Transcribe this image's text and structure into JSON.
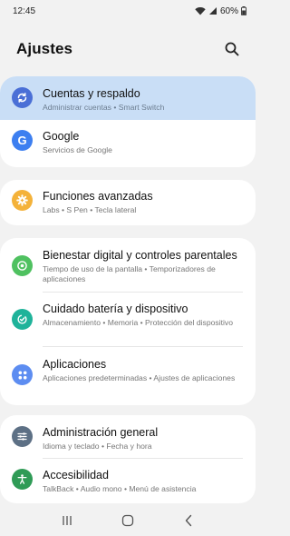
{
  "status_bar": {
    "time": "12:45",
    "battery": "60%"
  },
  "header": {
    "title": "Ajustes"
  },
  "colors": {
    "accent_blue": "#4a6fd6",
    "google_blue": "#3d7ff0",
    "advanced_yellow": "#f4b23a",
    "wellbeing_green": "#4fc160",
    "battery_teal": "#1fb39a",
    "apps_blue": "#5d8df1",
    "general_slate": "#5d7085",
    "accessibility_green": "#2f9b56",
    "highlight_bg": "#c9def6"
  },
  "cards": [
    {
      "items": [
        {
          "label": "Cuentas y respaldo",
          "sub": "Administrar cuentas  •  Smart Switch",
          "icon": "sync-icon",
          "highlighted": true
        },
        {
          "label": "Google",
          "sub": "Servicios de Google",
          "icon": "google-icon"
        }
      ]
    },
    {
      "items": [
        {
          "label": "Funciones avanzadas",
          "sub": "Labs  •  S Pen  •  Tecla lateral",
          "icon": "gear-plus-icon"
        }
      ]
    },
    {
      "items": [
        {
          "label": "Bienestar digital y controles parentales",
          "sub": "Tiempo de uso de la pantalla  •  Temporizadores de aplicaciones",
          "icon": "wellbeing-icon"
        },
        {
          "label": "Cuidado batería y dispositivo",
          "sub": "Almacenamiento  •  Memoria  •  Protección del dispositivo",
          "icon": "device-care-icon"
        },
        {
          "label": "Aplicaciones",
          "sub": "Aplicaciones predeterminadas  •  Ajustes de aplicaciones",
          "icon": "apps-grid-icon"
        }
      ]
    },
    {
      "items": [
        {
          "label": "Administración general",
          "sub": "Idioma y teclado  •  Fecha y hora",
          "icon": "sliders-icon"
        },
        {
          "label": "Accesibilidad",
          "sub": "TalkBack  •  Audio mono  •  Menú de asistencia",
          "icon": "accessibility-icon"
        }
      ]
    }
  ]
}
